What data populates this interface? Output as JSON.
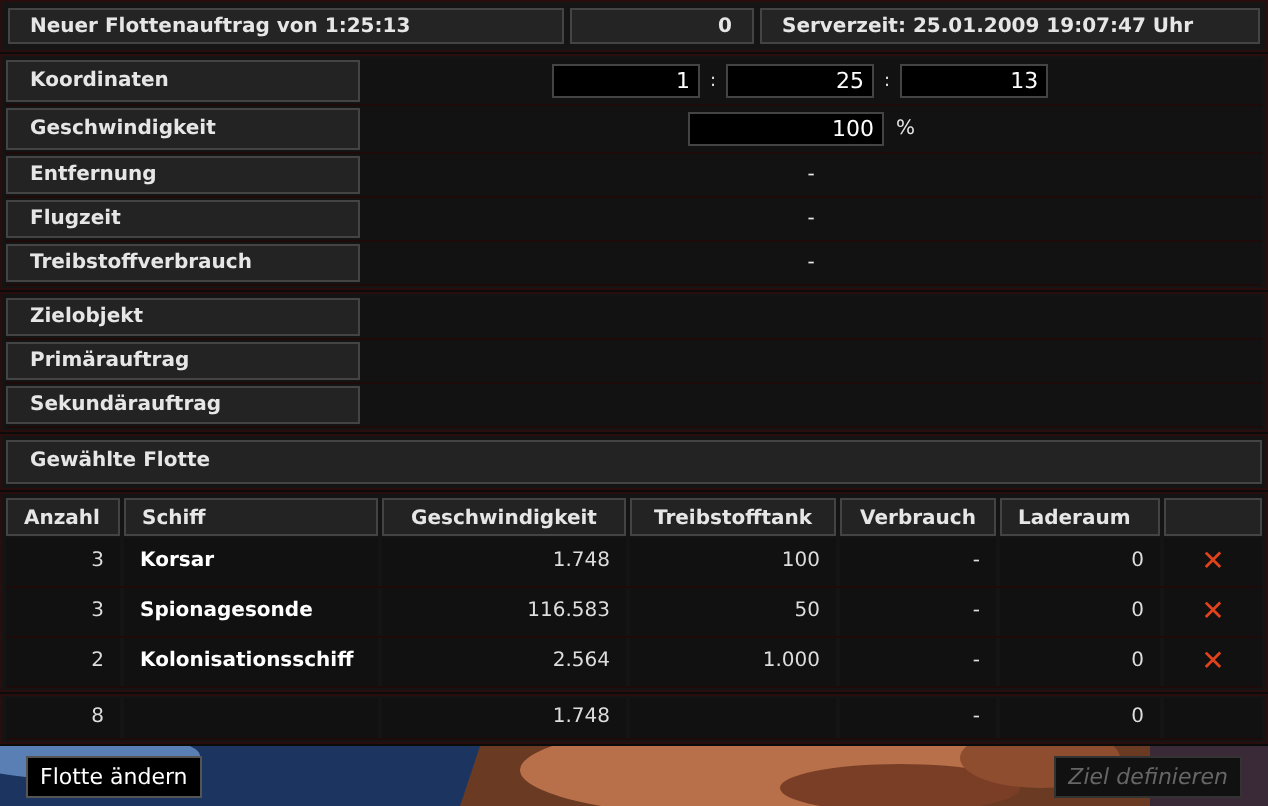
{
  "header": {
    "title": "Neuer Flottenauftrag von 1:25:13",
    "count": "0",
    "server_time": "Serverzeit: 25.01.2009 19:07:47 Uhr"
  },
  "flight": [
    {
      "label": "Koordinaten",
      "kind": "coords",
      "values": [
        "1",
        "25",
        "13"
      ],
      "separator": ":"
    },
    {
      "label": "Geschwindigkeit",
      "kind": "speed",
      "value": "100",
      "unit": "%"
    },
    {
      "label": "Entfernung",
      "kind": "text",
      "value": "-"
    },
    {
      "label": "Flugzeit",
      "kind": "text",
      "value": "-"
    },
    {
      "label": "Treibstoffverbrauch",
      "kind": "text",
      "value": "-"
    }
  ],
  "target": [
    {
      "label": "Zielobjekt"
    },
    {
      "label": "Primärauftrag"
    },
    {
      "label": "Sekundärauftrag"
    }
  ],
  "fleet_title": "Gewählte Flotte",
  "table": {
    "columns": [
      "Anzahl",
      "Schiff",
      "Geschwindigkeit",
      "Treibstofftank",
      "Verbrauch",
      "Laderaum"
    ],
    "rows": [
      [
        "3",
        "Korsar",
        "1.748",
        "100",
        "-",
        "0"
      ],
      [
        "3",
        "Spionagesonde",
        "116.583",
        "50",
        "-",
        "0"
      ],
      [
        "2",
        "Kolonisationsschiff",
        "2.564",
        "1.000",
        "-",
        "0"
      ]
    ],
    "remove_icon": "✕",
    "total": {
      "count": "8",
      "speed": "1.748",
      "consumption": "-",
      "cargo": "0"
    }
  },
  "buttons": [
    {
      "label": "Flotte ändern",
      "disabled": false
    },
    {
      "label": "Ziel definieren",
      "disabled": true
    }
  ]
}
